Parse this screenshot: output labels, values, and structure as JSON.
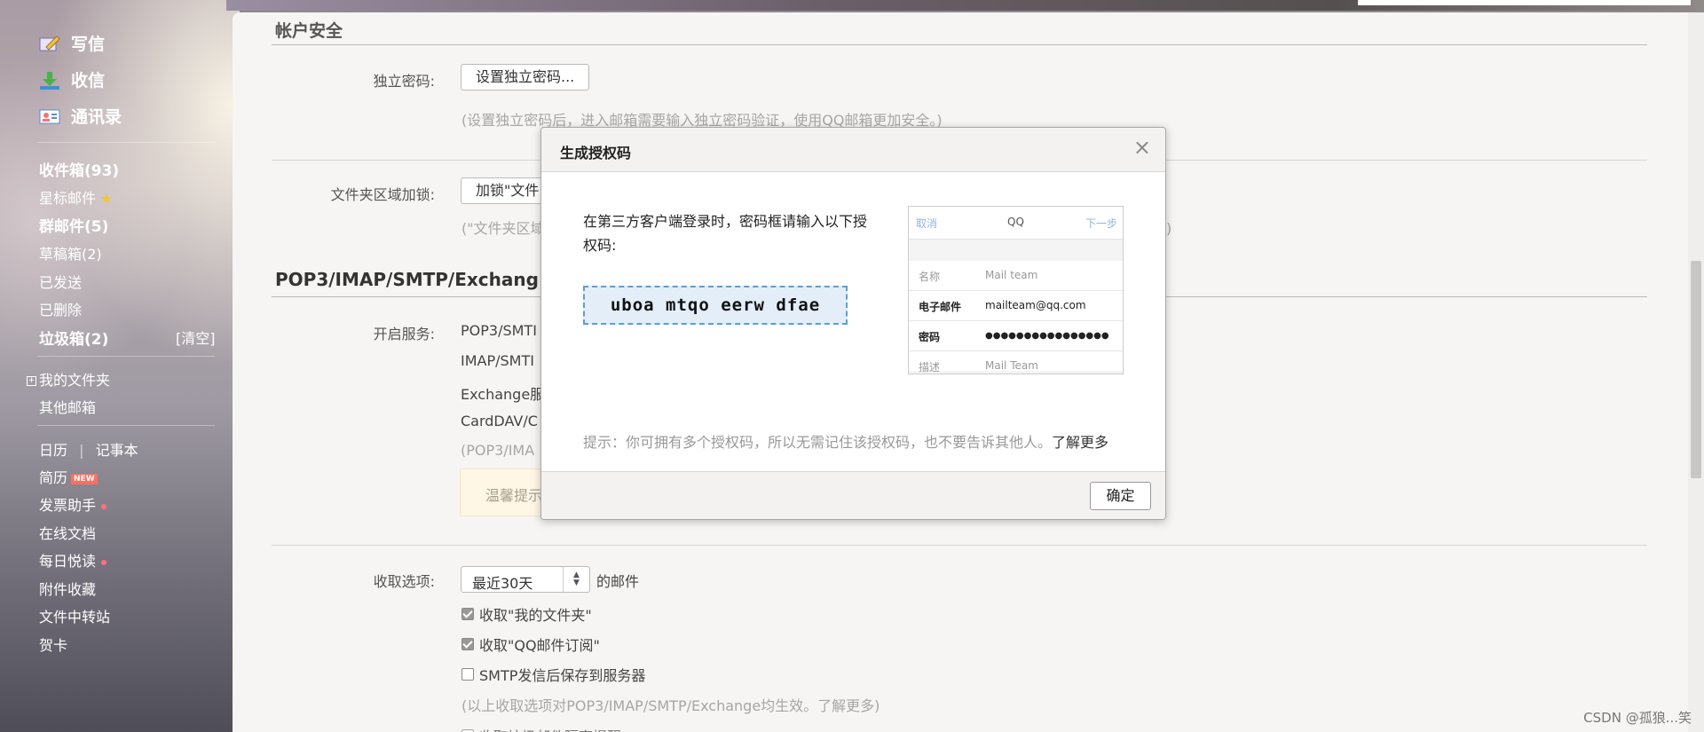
{
  "sidebar": {
    "compose": "写信",
    "receive": "收信",
    "contacts": "通讯录",
    "inbox": "收件箱(93)",
    "starred": "星标邮件",
    "group": "群邮件(5)",
    "drafts": "草稿箱(2)",
    "sent": "已发送",
    "deleted": "已删除",
    "spam": "垃圾箱(2)",
    "clear": "[清空]",
    "my_folders": "我的文件夹",
    "other_mailbox": "其他邮箱",
    "calendar": "日历",
    "notebook": "记事本",
    "resume": "简历",
    "new_badge": "NEW",
    "invoice": "发票助手",
    "online_docs": "在线文档",
    "daily_read": "每日悦读",
    "attachments": "附件收藏",
    "file_transfer": "文件中转站",
    "card": "贺卡"
  },
  "main": {
    "account_security_title": "帐户安全",
    "independent_pw_label": "独立密码:",
    "independent_pw_button": "设置独立密码...",
    "independent_pw_hint": "(设置独立密码后，进入邮箱需要输入独立密码验证，使用QQ邮箱更加安全。)",
    "folder_lock_label": "文件夹区域加锁:",
    "folder_lock_button": "加锁\"文件",
    "folder_lock_hint_left": "(\"文件夹区域",
    "folder_lock_hint_right": "。)",
    "pop_title": "POP3/IMAP/SMTP/Exchang",
    "service_label": "开启服务:",
    "service_pop3": "POP3/SMTI",
    "service_imap": "IMAP/SMTI",
    "service_exchange": "Exchange服",
    "service_carddav": "CardDAV/C",
    "service_hint": "(POP3/IMA",
    "tip_text": "温馨提示",
    "fetch_label": "收取选项:",
    "fetch_select": "最近30天",
    "fetch_suffix": "的邮件",
    "opt1": "收取\"我的文件夹\"",
    "opt2": "收取\"QQ邮件订阅\"",
    "opt3": "SMTP发信后保存到服务器",
    "opt_hint": "(以上收取选项对POP3/IMAP/SMTP/Exchange均生效。了解更多)",
    "opt4": "收取垃圾邮件隔离提醒"
  },
  "dialog": {
    "title": "生成授权码",
    "close": "×",
    "message": "在第三方客户端登录时，密码框请输入以下授权码:",
    "auth_code": "uboa mtqo eerw dfae",
    "tip": "提示：你可拥有多个授权码，所以无需记住该授权码，也不要告诉其他人。",
    "learn_more": "了解更多",
    "ok": "确定",
    "phone": {
      "cancel": "取消",
      "title": "QQ",
      "next": "下一步",
      "name_key": "名称",
      "name_val": "Mail team",
      "email_key": "电子邮件",
      "email_val": "mailteam@qq.com",
      "pw_key": "密码",
      "pw_val": "●●●●●●●●●●●●●●●●",
      "desc_key": "描述",
      "desc_val": "Mail Team"
    }
  },
  "watermark": "CSDN @孤狼...笑"
}
